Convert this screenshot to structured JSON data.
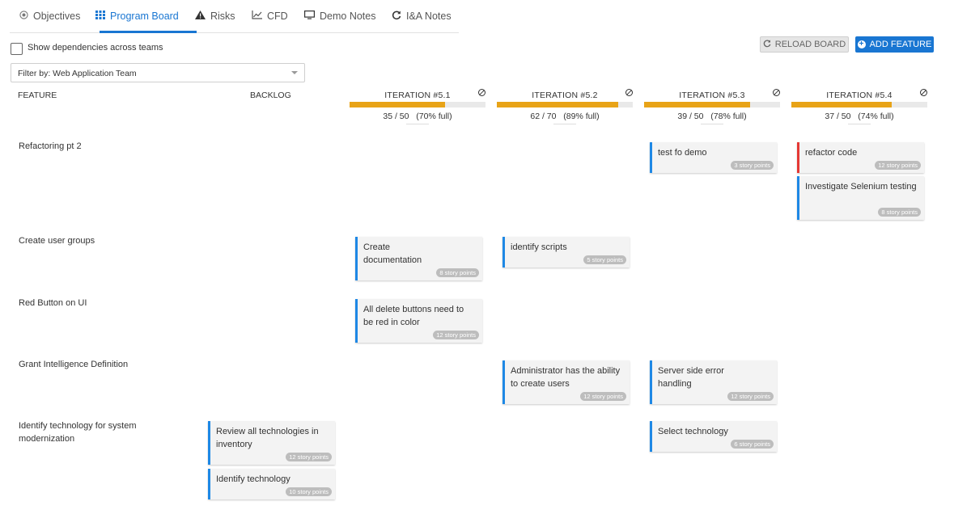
{
  "tabs": [
    {
      "label": "Objectives",
      "icon": "target-icon"
    },
    {
      "label": "Program Board",
      "icon": "grid-icon",
      "active": true
    },
    {
      "label": "Risks",
      "icon": "warning-icon"
    },
    {
      "label": "CFD",
      "icon": "line-chart-icon"
    },
    {
      "label": "Demo Notes",
      "icon": "monitor-icon"
    },
    {
      "label": "I&A Notes",
      "icon": "refresh-icon"
    }
  ],
  "dependencies_label": "Show dependencies across teams",
  "buttons": {
    "reload": "RELOAD BOARD",
    "add": "ADD FEATURE"
  },
  "filter": {
    "value": "Filter by: Web Application Team"
  },
  "columns": {
    "feature": "FEATURE",
    "backlog": "BACKLOG"
  },
  "iterations": [
    {
      "name": "ITERATION #5.1",
      "used": "35 / 50",
      "pct": "(70% full)",
      "fill": 0.7
    },
    {
      "name": "ITERATION #5.2",
      "used": "62 / 70",
      "pct": "(89% full)",
      "fill": 0.89
    },
    {
      "name": "ITERATION #5.3",
      "used": "39 / 50",
      "pct": "(78% full)",
      "fill": 0.78
    },
    {
      "name": "ITERATION #5.4",
      "used": "37 / 50",
      "pct": "(74% full)",
      "fill": 0.74
    }
  ],
  "features": [
    {
      "name": "Refactoring pt 2"
    },
    {
      "name": "Create user groups"
    },
    {
      "name": "Red Button on UI"
    },
    {
      "name": "Grant Intelligence Definition"
    },
    {
      "name": "Identify technology for system modernization"
    }
  ],
  "cards": [
    {
      "title": "test fo demo",
      "points": "3 story points"
    },
    {
      "title": "refactor code",
      "points": "12 story points"
    },
    {
      "title": "Investigate Selenium testing",
      "points": "8 story points"
    },
    {
      "title": "Create documentation",
      "points": "8 story points"
    },
    {
      "title": "identify scripts",
      "points": "5 story points"
    },
    {
      "title": "All delete buttons need to be red in color",
      "points": "12 story points"
    },
    {
      "title": "Administrator has the ability to create users",
      "points": "12 story points"
    },
    {
      "title": "Server side error handling",
      "points": "12 story points"
    },
    {
      "title": "Review all technologies in inventory",
      "points": "12 story points"
    },
    {
      "title": "Select technology",
      "points": "6 story points"
    },
    {
      "title": "Identify technology",
      "points": "10 story points"
    }
  ]
}
